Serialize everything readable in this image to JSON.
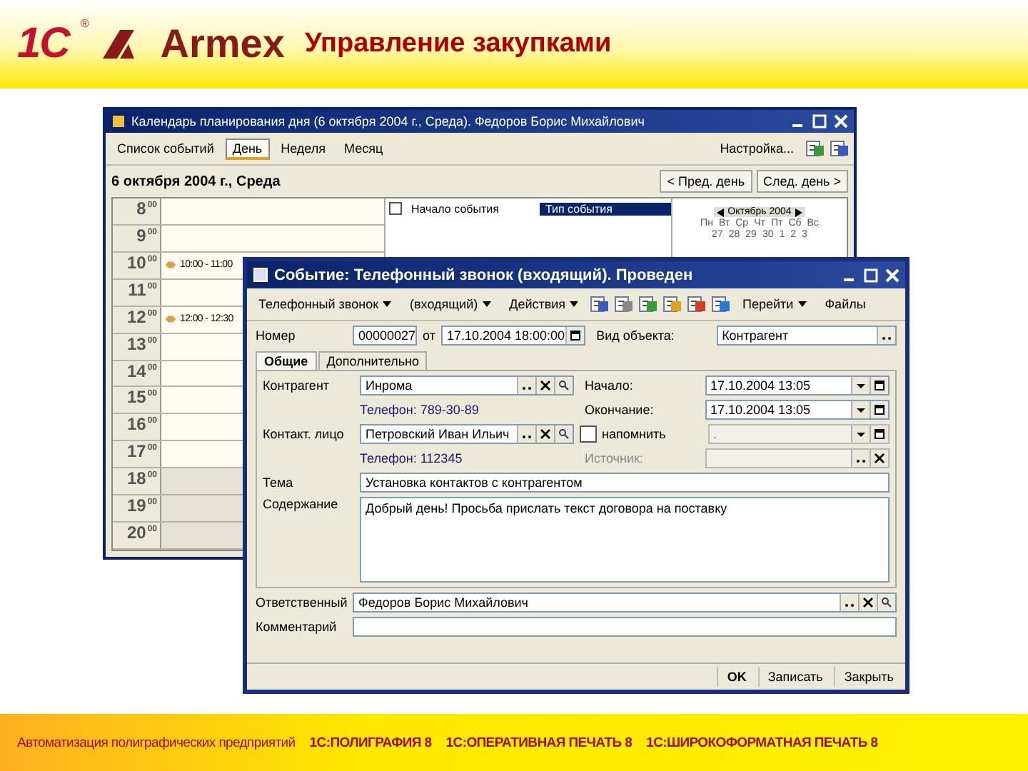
{
  "slide": {
    "logo_main": "1С",
    "logo_mark": "®",
    "logo_second": "Armex",
    "title": "Управление закупками"
  },
  "calendar_window": {
    "title": "Календарь планирования дня (6 октября 2004 г., Среда). Федоров Борис Михайлович",
    "toolbar": [
      {
        "label": "Список событий",
        "selected": false
      },
      {
        "label": "День",
        "selected": true
      },
      {
        "label": "Неделя",
        "selected": false
      },
      {
        "label": "Месяц",
        "selected": false
      }
    ],
    "settings": "Настройка...",
    "date": "6 октября 2004 г., Среда",
    "prev": "< Пред. день",
    "next": "След. день >",
    "hours": [
      {
        "label": "8",
        "mm": "00",
        "off_hours": false
      },
      {
        "label": "9",
        "mm": "00",
        "off_hours": false
      },
      {
        "label": "10",
        "mm": "00",
        "off_hours": false,
        "event": "10:00 - 11:00"
      },
      {
        "label": "11",
        "mm": "00",
        "off_hours": false
      },
      {
        "label": "12",
        "mm": "00",
        "off_hours": false,
        "event": "12:00 - 12:30"
      },
      {
        "label": "13",
        "mm": "00",
        "off_hours": false
      },
      {
        "label": "14",
        "mm": "00",
        "off_hours": false
      },
      {
        "label": "15",
        "mm": "00",
        "off_hours": false
      },
      {
        "label": "16",
        "mm": "00",
        "off_hours": false
      },
      {
        "label": "17",
        "mm": "00",
        "off_hours": false
      },
      {
        "label": "18",
        "mm": "00",
        "off_hours": true
      },
      {
        "label": "19",
        "mm": "00",
        "off_hours": true
      },
      {
        "label": "20",
        "mm": "00",
        "off_hours": true
      }
    ],
    "list_columns": [
      {
        "label": "Начало события",
        "selected": false
      },
      {
        "label": "Тип события",
        "selected": true
      }
    ],
    "month": "Октябрь 2004",
    "weekdays": [
      "Пн",
      "Вт",
      "Ср",
      "Чт",
      "Пт",
      "Сб",
      "Вс"
    ],
    "days": [
      "27",
      "28",
      "29",
      "30",
      "1",
      "2",
      "3"
    ]
  },
  "event_window": {
    "title": "Событие: Телефонный звонок (входящий). Проведен",
    "toolbar": [
      {
        "label": "Телефонный звонок",
        "dropdown": true
      },
      {
        "label": "(входящий)",
        "dropdown": true
      },
      {
        "label": "Действия",
        "dropdown": true
      }
    ],
    "goto": "Перейти",
    "files": "Файлы",
    "number_label": "Номер",
    "number": "00000027",
    "from_label": "от",
    "from": "17.10.2004 18:00:00",
    "object_label": "Вид объекта:",
    "object": "Контрагент",
    "tabs": [
      {
        "label": "Общие",
        "selected": true
      },
      {
        "label": "Дополнительно",
        "selected": false
      }
    ],
    "counterparty_label": "Контрагент",
    "counterparty": "Инрома",
    "counterparty_phone": "Телефон: 789-30-89",
    "start_label": "Начало:",
    "start": "17.10.2004 13:05",
    "end_label": "Окончание:",
    "end": "17.10.2004 13:05",
    "contact_label": "Контакт. лицо",
    "contact": "Петровский Иван Ильич",
    "contact_phone": "Телефон: 112345",
    "remind": {
      "label": "напомнить",
      "checked": false
    },
    "remind_value": ".",
    "source_label": "Источник:",
    "subject_label": "Тема",
    "subject": "Установка контактов с контрагентом",
    "content_label": "Содержание",
    "content": "Добрый день! Просьба прислать текст договора на поставку",
    "responsible_label": "Ответственный",
    "responsible": "Федоров Борис Михайлович",
    "comment_label": "Комментарий",
    "buttons": [
      "OK",
      "Записать",
      "Закрыть"
    ]
  },
  "footer": {
    "caption": "Автоматизация полиграфических предприятий",
    "products": [
      "1С:ПОЛИГРАФИЯ 8",
      "1С:ОПЕРАТИВНАЯ ПЕЧАТЬ 8",
      "1С:ШИРОКОФОРМАТНАЯ ПЕЧАТЬ 8"
    ]
  }
}
